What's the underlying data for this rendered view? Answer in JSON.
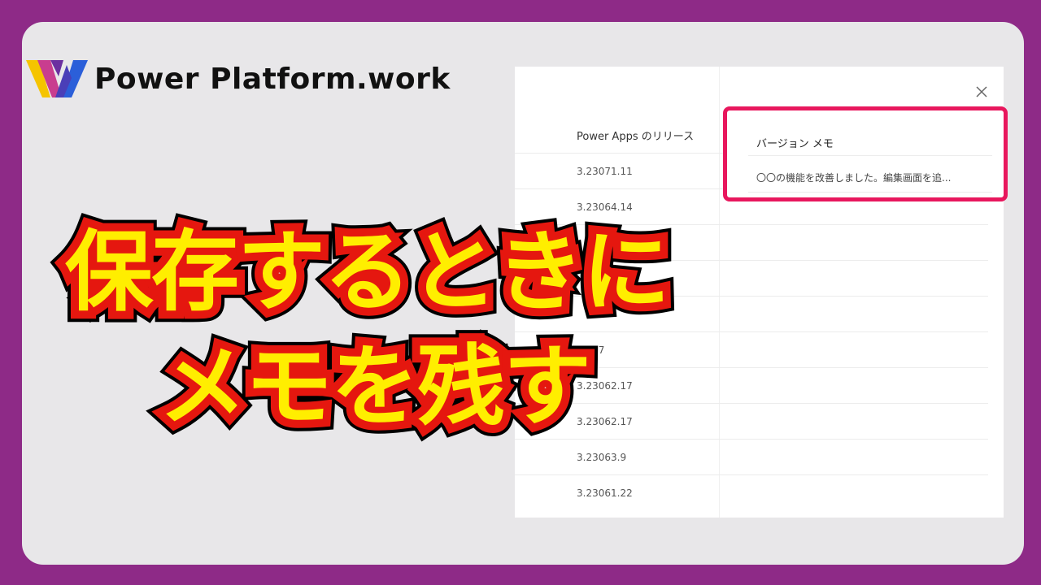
{
  "brand": {
    "name": "Power Platform.work",
    "colors": {
      "yellow": "#f5c400",
      "purple": "#6b2fa0",
      "blue": "#2b5fd9"
    }
  },
  "panel": {
    "column_header": "Power Apps のリリース",
    "versions": [
      "3.23071.11",
      "3.23064.14",
      "",
      "",
      "",
      "62.17",
      "3.23062.17",
      "3.23062.17",
      "3.23063.9",
      "3.23061.22"
    ],
    "close_icon": "close-icon"
  },
  "memo": {
    "label": "バージョン メモ",
    "value": "〇〇の機能を改善しました。編集画面を追..."
  },
  "headline": {
    "line1": "保存するときに",
    "line2": "メモを残す"
  },
  "colors": {
    "frame": "#8e2a87",
    "background": "#e8e7e9",
    "highlight": "#e8175d",
    "headline_fill": "#ffee00",
    "headline_outline": "#e5170f"
  }
}
